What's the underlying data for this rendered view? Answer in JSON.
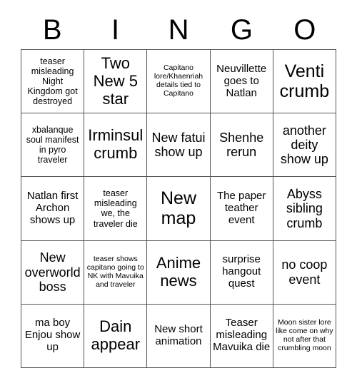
{
  "card": {
    "title_letters": [
      "B",
      "I",
      "N",
      "G",
      "O"
    ],
    "columns": 5,
    "rows": 5,
    "colors": {
      "background": "#ffffff",
      "text": "#000000",
      "border": "#555555"
    },
    "cells": [
      {
        "text": "teaser misleading Night Kingdom got destroyed",
        "size": "sm"
      },
      {
        "text": "Two New 5 star",
        "size": "xl"
      },
      {
        "text": "Capitano lore/Khaenriah details tied to Capitano",
        "size": "xs"
      },
      {
        "text": "Neuvillette goes to Natlan",
        "size": "md"
      },
      {
        "text": "Venti crumb",
        "size": "xxl"
      },
      {
        "text": "xbalanque soul manifest in pyro traveler",
        "size": "sm"
      },
      {
        "text": "Irminsul crumb",
        "size": "xl"
      },
      {
        "text": "New fatui show up",
        "size": "lg"
      },
      {
        "text": "Shenhe rerun",
        "size": "lg"
      },
      {
        "text": "another deity show up",
        "size": "lg"
      },
      {
        "text": "Natlan first Archon shows up",
        "size": "md"
      },
      {
        "text": "teaser misleading we, the traveler die",
        "size": "sm"
      },
      {
        "text": "New map",
        "size": "xxl"
      },
      {
        "text": "The paper teather event",
        "size": "md"
      },
      {
        "text": "Abyss sibling crumb",
        "size": "lg"
      },
      {
        "text": "New overworld boss",
        "size": "lg"
      },
      {
        "text": "teaser shows capitano going to NK with Mavuika and traveler",
        "size": "xs"
      },
      {
        "text": "Anime news",
        "size": "xl"
      },
      {
        "text": "surprise hangout quest",
        "size": "md"
      },
      {
        "text": "no coop event",
        "size": "lg"
      },
      {
        "text": "ma boy Enjou show up",
        "size": "md"
      },
      {
        "text": "Dain appear",
        "size": "xl"
      },
      {
        "text": "New short animation",
        "size": "md"
      },
      {
        "text": "Teaser misleading Mavuika die",
        "size": "md"
      },
      {
        "text": "Moon sister lore like come on why not after that crumbling moon",
        "size": "xs"
      }
    ]
  }
}
